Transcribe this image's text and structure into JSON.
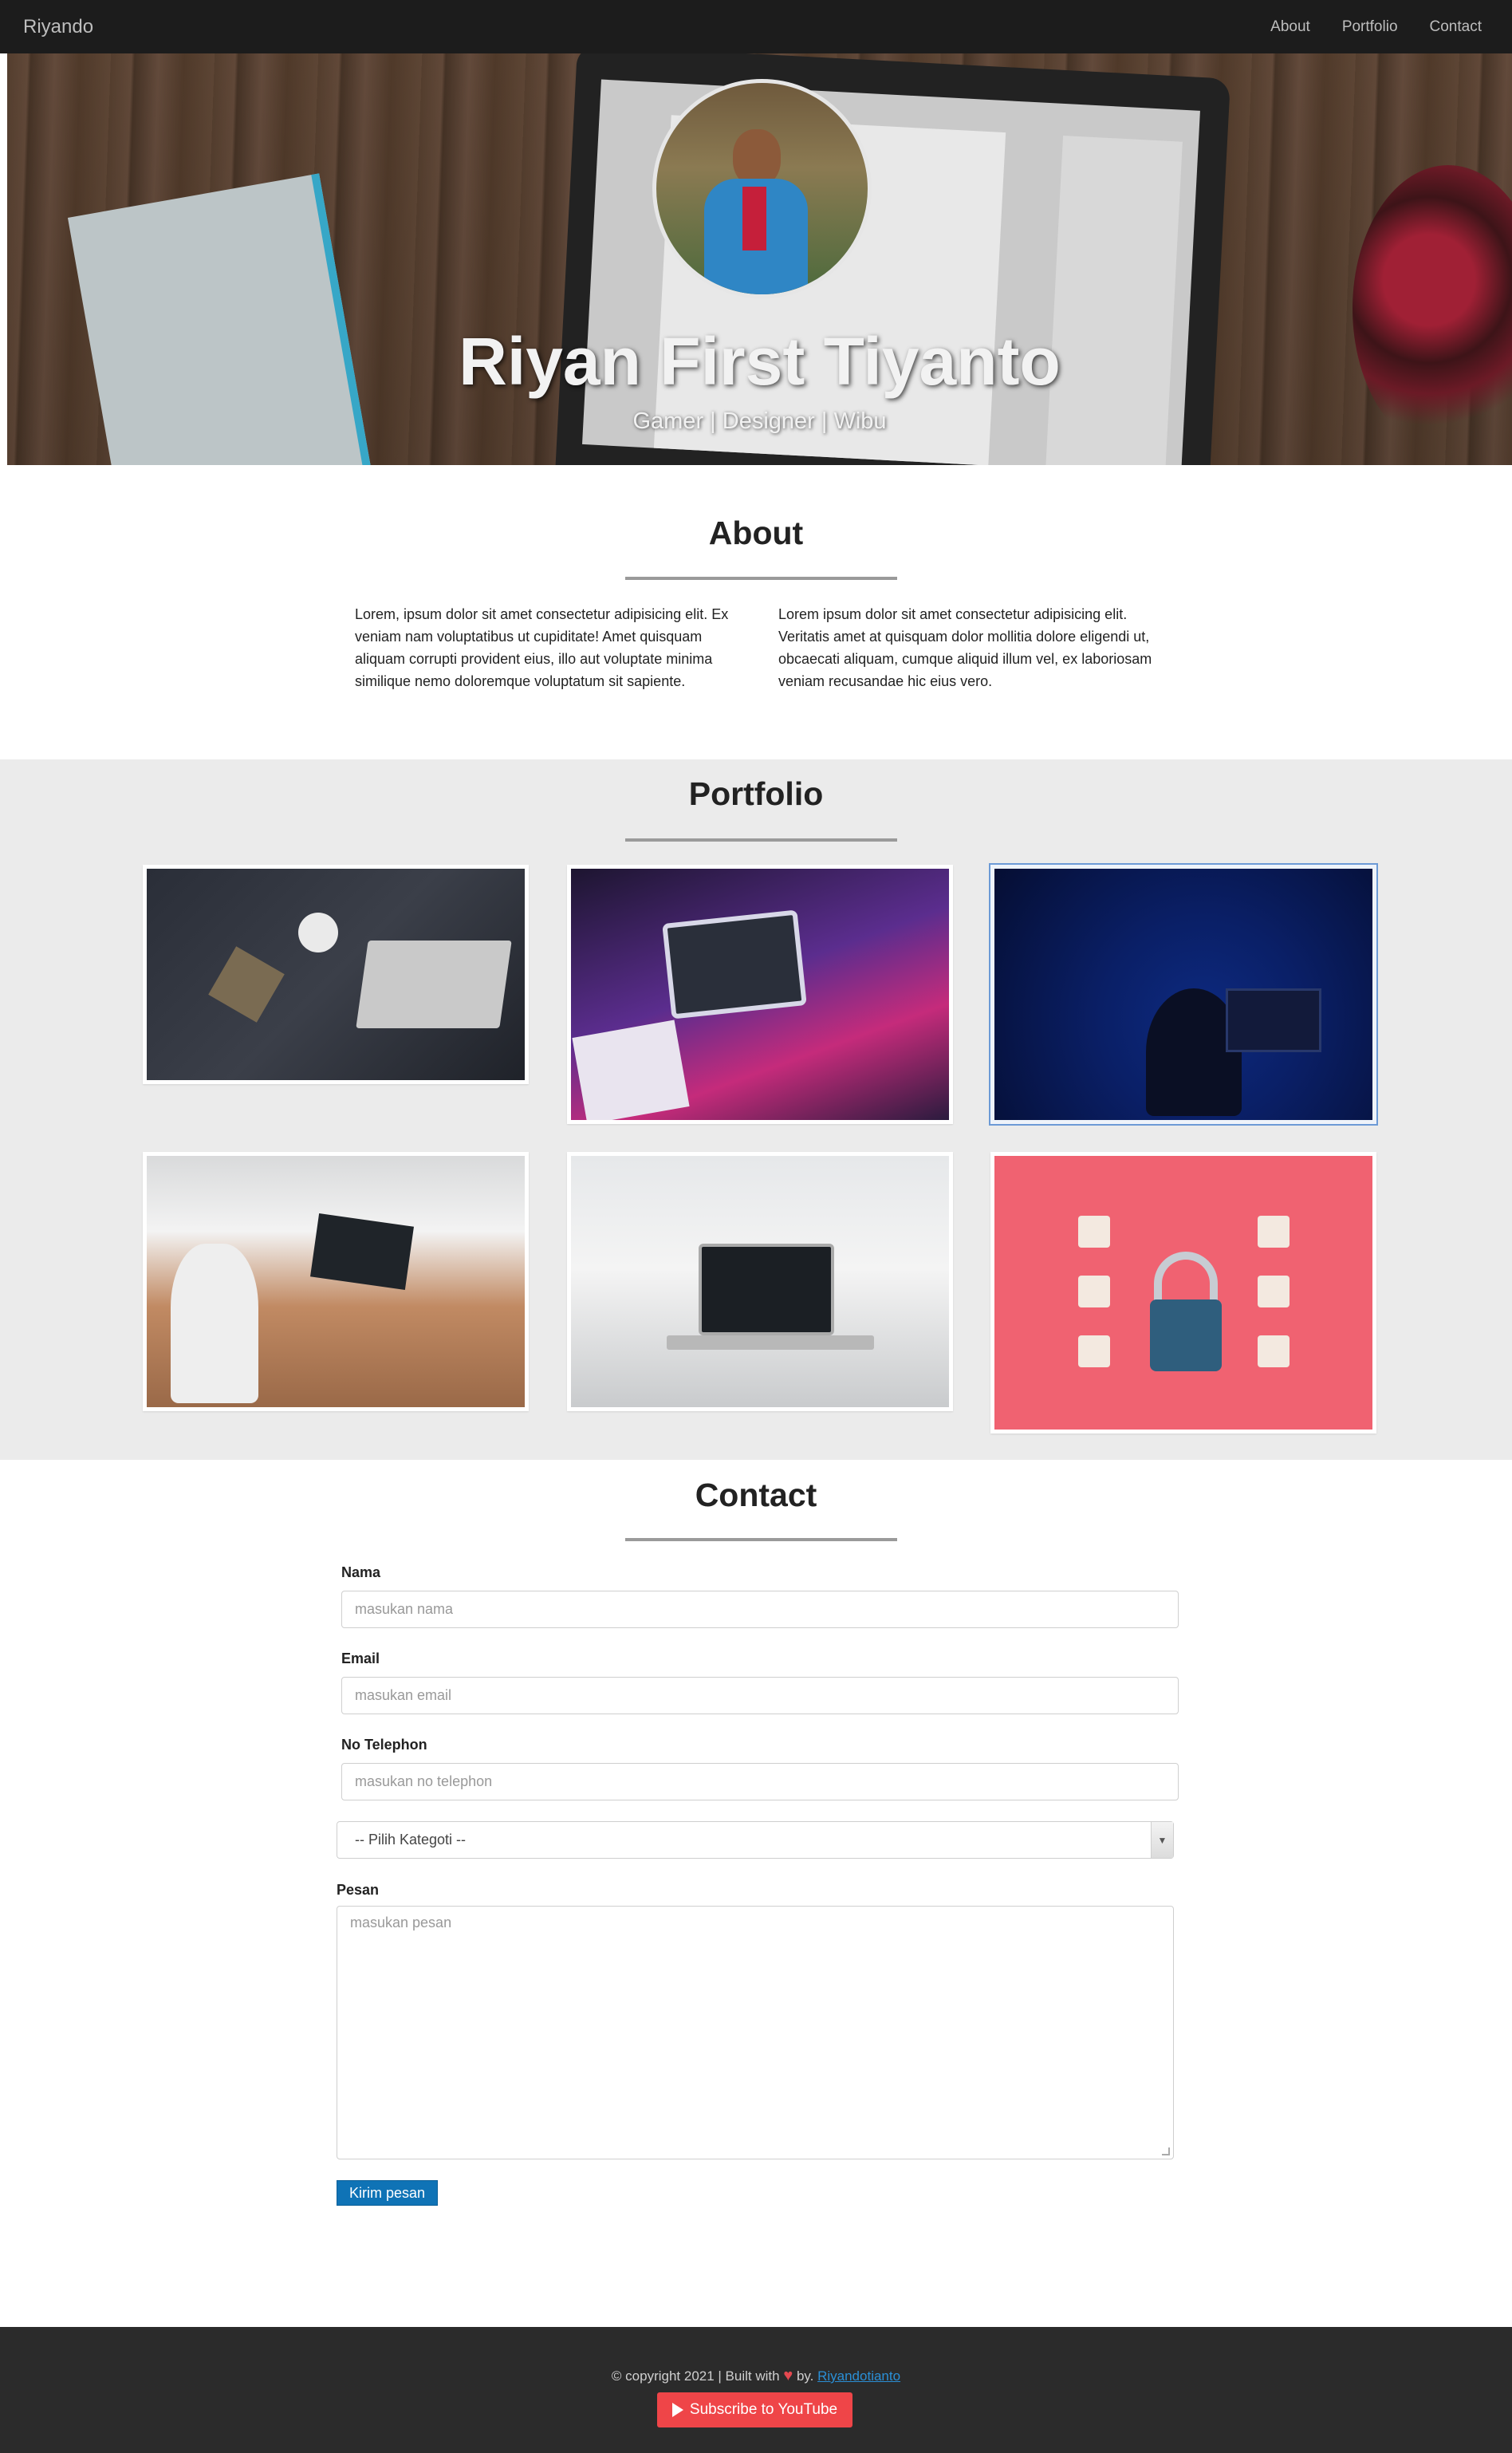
{
  "navbar": {
    "brand": "Riyando",
    "links": [
      "About",
      "Portfolio",
      "Contact"
    ]
  },
  "hero": {
    "name": "Riyan First Tiyanto",
    "tagline": "Gamer | Designer | Wibu"
  },
  "about": {
    "title": "About",
    "col1": "Lorem, ipsum dolor sit amet consectetur adipisicing elit. Ex veniam nam voluptatibus ut cupiditate! Amet quisquam aliquam corrupti provident eius, illo aut voluptate minima similique nemo doloremque voluptatum sit sapiente.",
    "col2": "Lorem ipsum dolor sit amet consectetur adipisicing elit. Veritatis amet at quisquam dolor mollitia dolore eligendi ut, obcaecati aliquam, cumque aliquid illum vel, ex laboriosam veniam recusandae hic eius vero."
  },
  "portfolio": {
    "title": "Portfolio"
  },
  "contact": {
    "title": "Contact",
    "nama_label": "Nama",
    "nama_placeholder": "masukan nama",
    "email_label": "Email",
    "email_placeholder": "masukan email",
    "phone_label": "No Telephon",
    "phone_placeholder": "masukan no telephon",
    "category_selected": "-- Pilih Kategoti --",
    "message_label": "Pesan",
    "message_placeholder": "masukan pesan",
    "submit_label": "Kirim pesan"
  },
  "footer": {
    "copyright": "© copyright 2021 | Built with",
    "by": "by.",
    "author": "Riyandotianto",
    "youtube_label": "Subscribe to YouTube"
  },
  "colors": {
    "navbar": "#1c1c1c",
    "portfolio_bg": "#ebebeb",
    "submit_button": "#0f73b6",
    "youtube_button": "#ef4548",
    "footer": "#2b2b2b",
    "author_link": "#2a8fd6"
  }
}
